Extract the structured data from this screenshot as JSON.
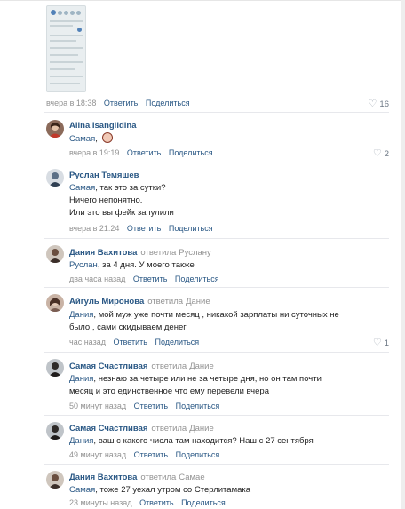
{
  "top_post": {
    "time": "вчера в 18:38",
    "reply_label": "Ответить",
    "share_label": "Поделиться",
    "likes": "16"
  },
  "comments": [
    {
      "author": "Alina Isangildina",
      "mention": "Самая",
      "text_lines": [
        ","
      ],
      "time": "вчера в 19:19",
      "reply_label": "Ответить",
      "share_label": "Поделиться",
      "likes": "2"
    },
    {
      "author": "Руслан Темяшев",
      "mention": "Самая",
      "text_lines": [
        ", так это за сутки?",
        "Ничего непонятно.",
        "Или это вы фейк запулили"
      ],
      "time": "вчера в 21:24",
      "reply_label": "Ответить",
      "share_label": "Поделиться"
    },
    {
      "author": "Дания Вахитова",
      "replied_label": "ответила",
      "replied_to": "Руслану",
      "mention": "Руслан",
      "text_lines": [
        ", за 4 дня. У моего также"
      ],
      "time": "два часа назад",
      "reply_label": "Ответить",
      "share_label": "Поделиться"
    },
    {
      "author": "Айгуль Миронова",
      "replied_label": "ответила",
      "replied_to": "Дание",
      "mention": "Дания",
      "text_lines": [
        ", мой муж уже почти месяц , никакой зарплаты ни суточных не",
        "было , сами скидываем денег"
      ],
      "time": "час назад",
      "reply_label": "Ответить",
      "share_label": "Поделиться",
      "likes": "1"
    },
    {
      "author": "Самая Счастливая",
      "replied_label": "ответила",
      "replied_to": "Дание",
      "mention": "Дания",
      "text_lines": [
        ", незнаю за четыре или не за четыре дня, но он там почти",
        "месяц и это единственное что ему перевели вчера"
      ],
      "time": "50 минут назад",
      "reply_label": "Ответить",
      "share_label": "Поделиться"
    },
    {
      "author": "Самая Счастливая",
      "replied_label": "ответила",
      "replied_to": "Дание",
      "mention": "Дания",
      "text_lines": [
        ", ваш с какого числа там находится? Наш с 27 сентября"
      ],
      "time": "49 минут назад",
      "reply_label": "Ответить",
      "share_label": "Поделиться"
    },
    {
      "author": "Дания Вахитова",
      "replied_label": "ответила",
      "replied_to": "Самае",
      "mention": "Самая",
      "text_lines": [
        ", тоже 27 уехал утром со Стерлитамака"
      ],
      "time": "23 минуты назад",
      "reply_label": "Ответить",
      "share_label": "Поделиться"
    }
  ],
  "colors": {
    "link": "#2a5885",
    "meta": "#939393",
    "text": "#222222",
    "divider": "#e7e8ec"
  },
  "icons": {
    "like": "heart-outline-icon"
  }
}
